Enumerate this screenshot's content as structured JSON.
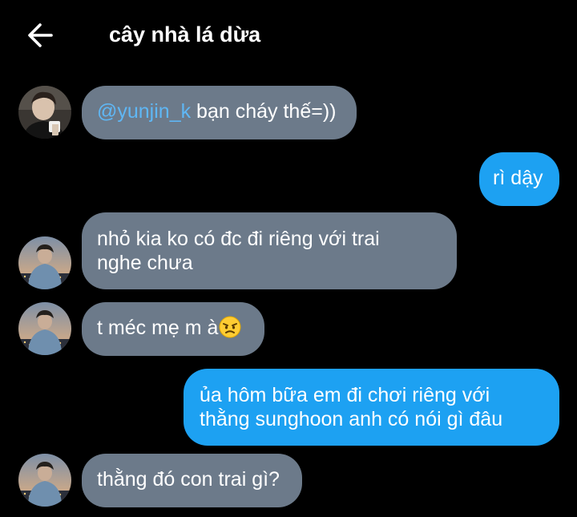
{
  "header": {
    "title": "cây nhà lá dừa",
    "back_icon": "arrow-left-icon"
  },
  "colors": {
    "background": "#000000",
    "incoming_bubble": "#6c7a8a",
    "outgoing_bubble": "#1da1f2",
    "mention": "#5fb7f5"
  },
  "messages": [
    {
      "direction": "incoming",
      "avatar": "avatar-photo-mug",
      "mention": "@yunjin_k",
      "text": " bạn cháy thế=))"
    },
    {
      "direction": "outgoing",
      "text": "rì dậy"
    },
    {
      "direction": "incoming",
      "avatar": "avatar-photo-city",
      "lines": [
        "nhỏ kia ko có đc đi riêng với trai",
        "nghe chưa"
      ]
    },
    {
      "direction": "incoming",
      "avatar": "avatar-photo-city",
      "text": "t méc mẹ m à",
      "emoji": "angry-face-emoji"
    },
    {
      "direction": "outgoing",
      "lines": [
        "ủa hôm bữa em đi chơi riêng với",
        "thằng sunghoon anh có nói gì đâu"
      ]
    },
    {
      "direction": "incoming",
      "avatar": "avatar-photo-city",
      "text": "thằng đó con trai gì?"
    }
  ]
}
